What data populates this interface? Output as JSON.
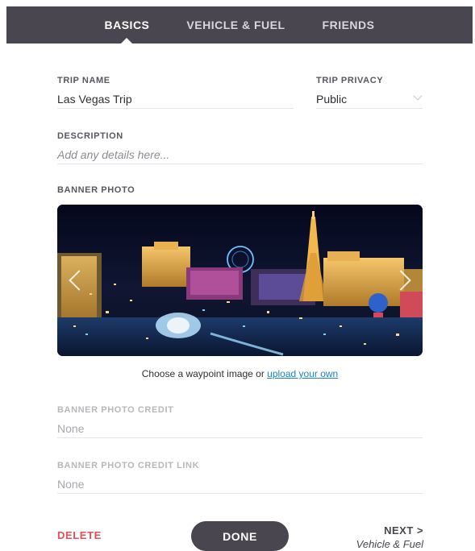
{
  "tabs": [
    {
      "label": "BASICS",
      "active": true
    },
    {
      "label": "VEHICLE & FUEL",
      "active": false
    },
    {
      "label": "FRIENDS",
      "active": false
    }
  ],
  "trip_name": {
    "label": "TRIP NAME",
    "value": "Las Vegas Trip"
  },
  "trip_privacy": {
    "label": "TRIP PRIVACY",
    "value": "Public"
  },
  "description": {
    "label": "DESCRIPTION",
    "placeholder": "Add any details here..."
  },
  "banner_photo": {
    "label": "BANNER PHOTO"
  },
  "caption": {
    "text": "Choose a waypoint image or ",
    "link": "upload your own"
  },
  "banner_credit": {
    "label": "BANNER PHOTO CREDIT",
    "value": "None"
  },
  "banner_credit_link": {
    "label": "BANNER PHOTO CREDIT LINK",
    "value": "None"
  },
  "footer": {
    "delete_label": "DELETE",
    "done_label": "DONE",
    "next_label": "NEXT >",
    "next_sub": "Vehicle & Fuel"
  },
  "colors": {
    "header": "#4a4650",
    "delete": "#e0505a",
    "link": "#1a86c8"
  },
  "icons": {
    "prev": "chevron-left-icon",
    "next": "chevron-right-icon",
    "dropdown": "chevron-down-icon"
  }
}
